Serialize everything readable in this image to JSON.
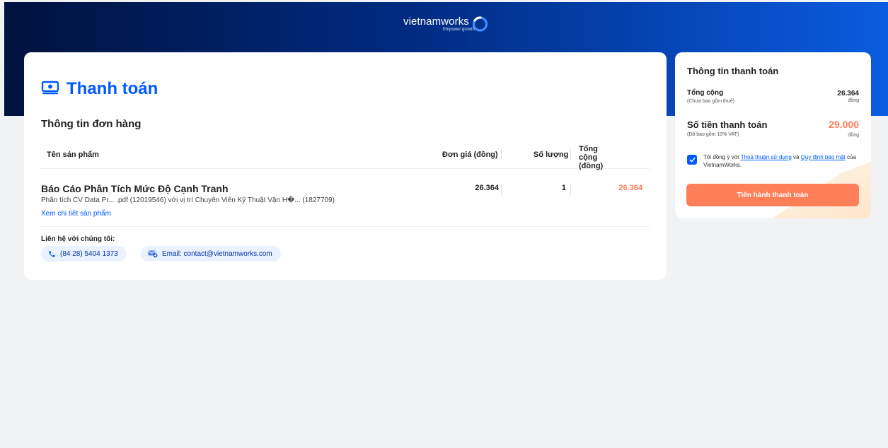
{
  "header": {
    "logo_text": "vietnamworks",
    "logo_tagline": "Empower growth"
  },
  "page": {
    "title": "Thanh toán"
  },
  "order": {
    "section_title": "Thông tin đơn hàng",
    "columns": {
      "product": "Tên sản phẩm",
      "unit_price": "Đơn giá (đồng)",
      "quantity": "Số lượng",
      "total": "Tổng cộng (đồng)"
    },
    "items": [
      {
        "name": "Báo Cáo Phân Tích Mức Độ Cạnh Tranh",
        "description": "Phân tích CV Data Pr... .pdf (12019546) với vị trí Chuyên Viên Kỹ Thuật Vận H�... (1827709)",
        "link": "Xem chi tiết sản phẩm",
        "unit_price": "26.364",
        "quantity": "1",
        "total": "26.364"
      }
    ]
  },
  "contact": {
    "title": "Liên hệ với chúng tôi:",
    "phone": "(84 28) 5404 1373",
    "email": "Email: contact@vietnamworks.com"
  },
  "payment": {
    "title": "Thông tin thanh toán",
    "subtotal_label": "Tổng cộng",
    "subtotal_note": "(Chưa bao gồm thuế)",
    "subtotal_value": "26.364",
    "currency": "đồng",
    "amount_label": "Số tiền thanh toán",
    "amount_note": "(Đã bao gồm 10% VAT)",
    "amount_value": "29.000",
    "agree_prefix": "Tôi đồng ý với ",
    "terms_link": "Thoả thuận sử dụng",
    "agree_and": " và ",
    "privacy_link": "Quy định bảo mật",
    "agree_suffix": " của VietnamWorks.",
    "agree_checked": true,
    "cta_label": "Tiến hành thanh toán"
  },
  "colors": {
    "brand_blue": "#005aff",
    "accent_orange": "#ff7f59",
    "header_dark": "#00123d"
  }
}
